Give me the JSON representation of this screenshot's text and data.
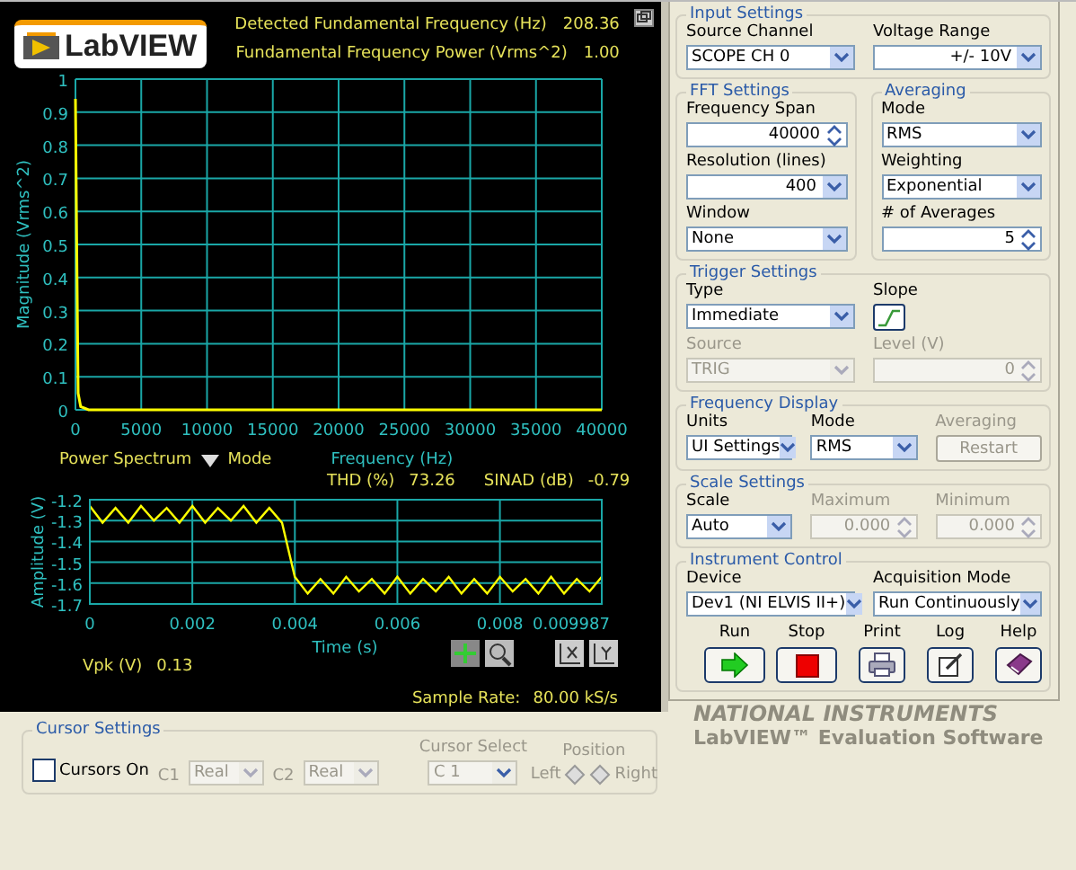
{
  "header": {
    "logo": "LabVIEW",
    "readouts": [
      {
        "label": "Detected Fundamental Frequency (Hz)",
        "value": "208.36"
      },
      {
        "label": "Fundamental Frequency Power (Vrms^2)",
        "value": "1.00"
      }
    ]
  },
  "spectrum": {
    "mode_value": "Power Spectrum",
    "mode_label": "Mode",
    "chart_data": {
      "type": "line",
      "xlabel": "Frequency (Hz)",
      "ylabel": "Magnitude (Vrms^2)",
      "xlim": [
        0,
        40000
      ],
      "ylim": [
        0,
        1
      ],
      "xticks": [
        0,
        5000,
        10000,
        15000,
        20000,
        25000,
        30000,
        35000,
        40000
      ],
      "yticks": [
        0,
        0.1,
        0.2,
        0.3,
        0.4,
        0.5,
        0.6,
        0.7,
        0.8,
        0.9,
        1
      ],
      "x": [
        0,
        100,
        208,
        400,
        1000,
        40000
      ],
      "grid": true,
      "series": [
        {
          "color": "#ffff00",
          "values": [
            0.94,
            0.5,
            0.05,
            0.01,
            0,
            0
          ]
        }
      ]
    }
  },
  "metrics": [
    {
      "label": "THD (%)",
      "value": "73.26"
    },
    {
      "label": "SINAD (dB)",
      "value": "-0.79"
    }
  ],
  "waveform": {
    "chart_data": {
      "type": "line",
      "xlabel": "Time (s)",
      "ylabel": "Amplitude (V)",
      "xlim": [
        0,
        0.009987
      ],
      "ylim": [
        -1.7,
        -1.2
      ],
      "xticks": [
        0,
        0.002,
        0.004,
        0.006,
        0.008,
        0.009987
      ],
      "yticks": [
        -1.7,
        -1.6,
        -1.5,
        -1.4,
        -1.3,
        -1.2
      ],
      "x": [
        0,
        0.00025,
        0.0005,
        0.00075,
        0.001,
        0.00125,
        0.0015,
        0.00175,
        0.002,
        0.00225,
        0.0025,
        0.00275,
        0.003,
        0.00325,
        0.0035,
        0.00375,
        0.004,
        0.00425,
        0.0045,
        0.00475,
        0.005,
        0.00525,
        0.0055,
        0.00575,
        0.006,
        0.00625,
        0.0065,
        0.00675,
        0.007,
        0.00725,
        0.0075,
        0.00775,
        0.008,
        0.00825,
        0.0085,
        0.00875,
        0.009,
        0.00925,
        0.0095,
        0.00975,
        0.009987
      ],
      "grid": true,
      "series": [
        {
          "color": "#ffff00",
          "values": [
            -1.23,
            -1.31,
            -1.24,
            -1.31,
            -1.23,
            -1.3,
            -1.24,
            -1.31,
            -1.23,
            -1.31,
            -1.24,
            -1.3,
            -1.23,
            -1.31,
            -1.24,
            -1.31,
            -1.57,
            -1.65,
            -1.58,
            -1.65,
            -1.57,
            -1.64,
            -1.58,
            -1.65,
            -1.57,
            -1.65,
            -1.58,
            -1.64,
            -1.57,
            -1.65,
            -1.58,
            -1.65,
            -1.57,
            -1.64,
            -1.58,
            -1.65,
            -1.57,
            -1.65,
            -1.58,
            -1.64,
            -1.57
          ]
        }
      ]
    }
  },
  "vpk": {
    "label": "Vpk (V)",
    "value": "0.13"
  },
  "sample_rate": {
    "label": "Sample Rate:",
    "value": "80.00 kS/s"
  },
  "cursor_settings": {
    "title": "Cursor Settings",
    "cursors_on": {
      "label": "Cursors On",
      "checked": false
    },
    "selectors": [
      {
        "label": "C1",
        "value": "Real",
        "disabled": true
      },
      {
        "label": "C2",
        "value": "Real",
        "disabled": true
      }
    ],
    "cursor_select": {
      "label": "Cursor Select",
      "value": "C 1",
      "disabled": true
    },
    "position": {
      "label": "Position",
      "left": "Left",
      "right": "Right"
    }
  },
  "right_panel": [
    [
      {
        "title": "Input Settings",
        "controls": [
          {
            "kind": "select",
            "label": "Source Channel",
            "value": "SCOPE CH 0",
            "disabled": false
          },
          {
            "kind": "ring",
            "label": "Voltage Range",
            "value": "+/- 10V",
            "disabled": false
          }
        ]
      }
    ],
    [
      {
        "title": "FFT Settings",
        "controls": [
          {
            "kind": "numeric",
            "label": "Frequency Span",
            "value": "40000",
            "disabled": false
          },
          {
            "kind": "ring",
            "label": "Resolution (lines)",
            "value": "400",
            "disabled": false
          },
          {
            "kind": "select",
            "label": "Window",
            "value": "None",
            "disabled": false
          }
        ]
      },
      {
        "title": "Averaging",
        "controls": [
          {
            "kind": "select",
            "label": "Mode",
            "value": "RMS",
            "disabled": false
          },
          {
            "kind": "select",
            "label": "Weighting",
            "value": "Exponential",
            "disabled": false
          },
          {
            "kind": "numeric",
            "label": "# of Averages",
            "value": "5",
            "disabled": false
          }
        ]
      }
    ],
    [
      {
        "title": "Trigger Settings",
        "controls": [
          {
            "kind": "select",
            "label": "Type",
            "value": "Immediate",
            "disabled": false
          },
          {
            "kind": "slope",
            "label": "Slope",
            "disabled": false
          },
          {
            "kind": "select",
            "label": "Source",
            "value": "TRIG",
            "disabled": true
          },
          {
            "kind": "numeric",
            "label": "Level (V)",
            "value": "0",
            "disabled": true
          }
        ]
      }
    ],
    [
      {
        "title": "Frequency Display",
        "controls": [
          {
            "kind": "select",
            "label": "Units",
            "value": "UI Settings",
            "disabled": false
          },
          {
            "kind": "select",
            "label": "Mode",
            "value": "RMS",
            "disabled": false
          },
          {
            "kind": "button",
            "label": "Averaging",
            "value": "Restart",
            "disabled": true
          }
        ]
      }
    ],
    [
      {
        "title": "Scale Settings",
        "controls": [
          {
            "kind": "select",
            "label": "Scale",
            "value": "Auto",
            "disabled": false
          },
          {
            "kind": "numeric",
            "label": "Maximum",
            "value": "0.000",
            "disabled": true
          },
          {
            "kind": "numeric",
            "label": "Minimum",
            "value": "0.000",
            "disabled": true
          }
        ]
      }
    ],
    [
      {
        "title": "Instrument Control",
        "controls": [
          {
            "kind": "select",
            "label": "Device",
            "value": "Dev1 (NI ELVIS II+)",
            "disabled": false
          },
          {
            "kind": "select",
            "label": "Acquisition Mode",
            "value": "Run Continuously",
            "disabled": false
          }
        ],
        "tools": [
          {
            "kind": "run",
            "label": "Run"
          },
          {
            "kind": "stop",
            "label": "Stop"
          },
          {
            "kind": "print",
            "label": "Print"
          },
          {
            "kind": "log",
            "label": "Log"
          },
          {
            "kind": "help",
            "label": "Help"
          }
        ]
      }
    ]
  ],
  "branding": {
    "company": "NATIONAL INSTRUMENTS",
    "product": "LabVIEW™ Evaluation Software"
  }
}
